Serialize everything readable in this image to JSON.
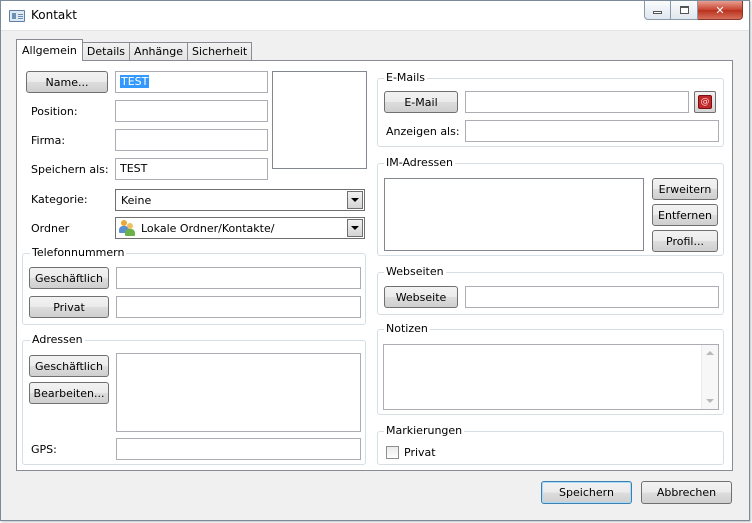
{
  "window": {
    "title": "Kontakt",
    "icon": "contact-card-icon"
  },
  "tabs": [
    "Allgemein",
    "Details",
    "Anhänge",
    "Sicherheit"
  ],
  "active_tab": "Allgemein",
  "left": {
    "name_button": "Name...",
    "name_value": "TEST",
    "position_label": "Position:",
    "position_value": "",
    "firma_label": "Firma:",
    "firma_value": "",
    "speichern_als_label": "Speichern als:",
    "speichern_als_value": "TEST",
    "kategorie_label": "Kategorie:",
    "kategorie_value": "Keine",
    "ordner_label": "Ordner",
    "ordner_value": "Lokale Ordner/Kontakte/",
    "telefon": {
      "title": "Telefonnummern",
      "geschaeftlich_button": "Geschäftlich",
      "geschaeftlich_value": "",
      "privat_button": "Privat",
      "privat_value": ""
    },
    "adressen": {
      "title": "Adressen",
      "geschaeftlich_button": "Geschäftlich",
      "bearbeiten_button": "Bearbeiten...",
      "address_value": "",
      "gps_label": "GPS:",
      "gps_value": ""
    }
  },
  "right": {
    "emails": {
      "title": "E-Mails",
      "email_button": "E-Mail",
      "email_value": "",
      "anzeigen_als_label": "Anzeigen als:",
      "anzeigen_als_value": "",
      "email_icon_text": "@"
    },
    "im": {
      "title": "IM-Adressen",
      "erweitern_button": "Erweitern",
      "entfernen_button": "Entfernen",
      "profil_button": "Profil..."
    },
    "webseiten": {
      "title": "Webseiten",
      "webseite_button": "Webseite",
      "webseite_value": ""
    },
    "notizen": {
      "title": "Notizen",
      "value": ""
    },
    "markierungen": {
      "title": "Markierungen",
      "privat_label": "Privat",
      "privat_checked": false
    }
  },
  "footer": {
    "save_button": "Speichern",
    "cancel_button": "Abbrechen"
  }
}
